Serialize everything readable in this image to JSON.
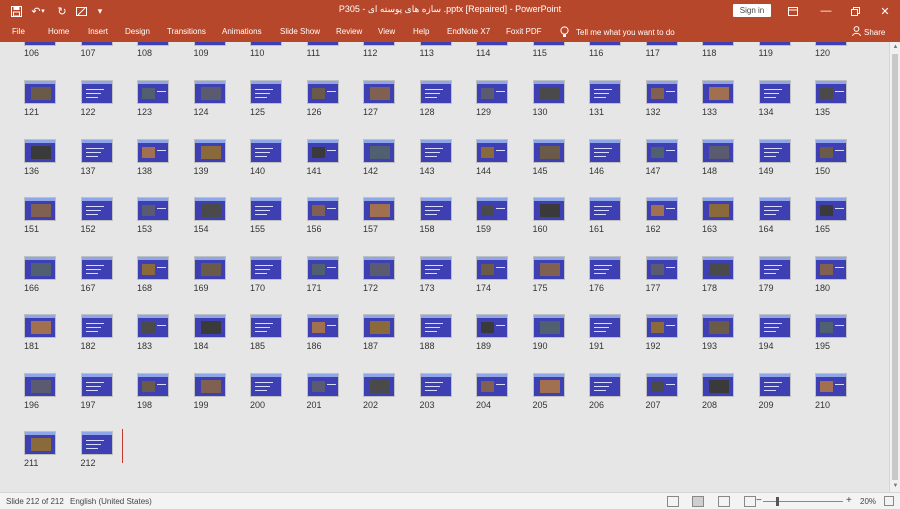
{
  "titlebar": {
    "title": "P305 - سازه های پوسته ای .pptx [Repaired]  -  PowerPoint",
    "signin": "Sign in",
    "icons": [
      "save-icon",
      "undo-icon",
      "redo-icon",
      "customize-icon",
      "ribbon-display-icon",
      "minimize-icon",
      "restore-icon",
      "close-icon"
    ]
  },
  "ribbon": {
    "tabs": [
      "File",
      "Home",
      "Insert",
      "Design",
      "Transitions",
      "Animations",
      "Slide Show",
      "Review",
      "View",
      "Help",
      "EndNote X7",
      "Foxit PDF"
    ],
    "tell_me": "Tell me what you want to do",
    "share": "Share"
  },
  "sorter": {
    "first_row_numbers": [
      "106",
      "107",
      "108",
      "109",
      "110",
      "111",
      "112",
      "113",
      "114",
      "115",
      "116",
      "117",
      "118",
      "119",
      "120"
    ],
    "slides": [
      "121",
      "122",
      "123",
      "124",
      "125",
      "126",
      "127",
      "128",
      "129",
      "130",
      "131",
      "132",
      "133",
      "134",
      "135",
      "136",
      "137",
      "138",
      "139",
      "140",
      "141",
      "142",
      "143",
      "144",
      "145",
      "146",
      "147",
      "148",
      "149",
      "150",
      "151",
      "152",
      "153",
      "154",
      "155",
      "156",
      "157",
      "158",
      "159",
      "160",
      "161",
      "162",
      "163",
      "164",
      "165",
      "166",
      "167",
      "168",
      "169",
      "170",
      "171",
      "172",
      "173",
      "174",
      "175",
      "176",
      "177",
      "178",
      "179",
      "180",
      "181",
      "182",
      "183",
      "184",
      "185",
      "186",
      "187",
      "188",
      "189",
      "190",
      "191",
      "192",
      "193",
      "194",
      "195",
      "196",
      "197",
      "198",
      "199",
      "200",
      "201",
      "202",
      "203",
      "204",
      "205",
      "206",
      "207",
      "208",
      "209",
      "210",
      "211",
      "212"
    ],
    "slide_color": "#3d3fb3",
    "selected_slide": "212"
  },
  "status": {
    "slide_info": "Slide 212 of 212",
    "language": "English (United States)",
    "zoom": "20%",
    "zoom_out": "−",
    "zoom_in": "+"
  }
}
